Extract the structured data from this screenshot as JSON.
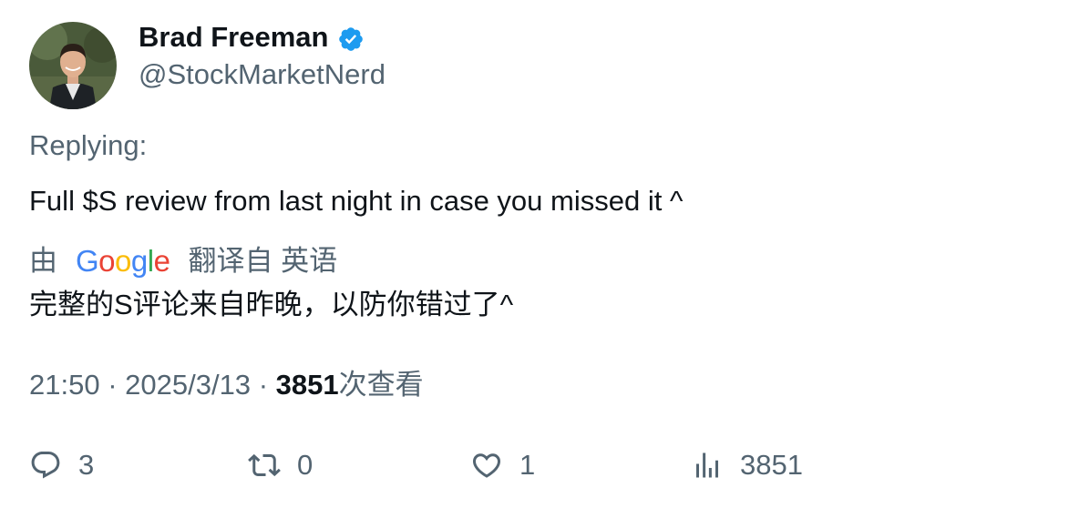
{
  "author": {
    "display_name": "Brad Freeman",
    "handle": "@StockMarketNerd",
    "verified": true
  },
  "replying_label": "Replying:",
  "tweet_text": "Full $S review from last night in case you missed it ^",
  "translation": {
    "prefix": "由",
    "provider": "Google",
    "suffix": "翻译自 英语",
    "text": "完整的S评论来自昨晚，以防你错过了^"
  },
  "meta": {
    "time": "21:50",
    "separator": "·",
    "date": "2025/3/13",
    "views_count": "3851",
    "views_label": "次查看"
  },
  "actions": {
    "reply_count": "3",
    "retweet_count": "0",
    "like_count": "1",
    "views_count": "3851"
  },
  "colors": {
    "text_primary": "#0f1419",
    "text_secondary": "#536471",
    "verified_blue": "#1d9bf0"
  }
}
